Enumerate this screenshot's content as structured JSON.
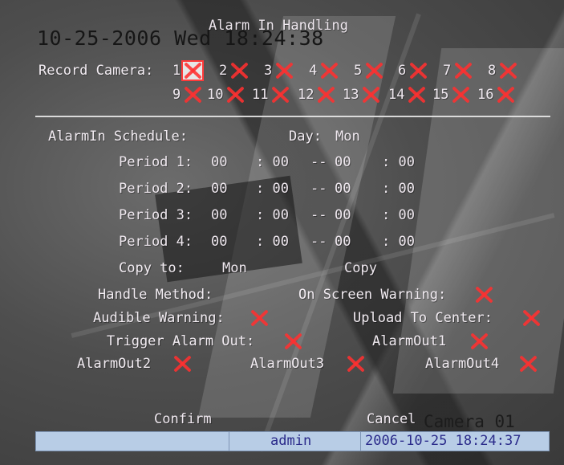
{
  "title": "Alarm In Handling",
  "clock": "10-25-2006 Wed 18:24:38",
  "record_camera": {
    "label": "Record Camera:",
    "cameras": [
      "1",
      "2",
      "3",
      "4",
      "5",
      "6",
      "7",
      "8",
      "9",
      "10",
      "11",
      "12",
      "13",
      "14",
      "15",
      "16"
    ],
    "selected": "1"
  },
  "schedule": {
    "label": "AlarmIn Schedule:",
    "day_label": "Day:",
    "day_value": "Mon",
    "periods": [
      {
        "label": "Period 1:",
        "start_h": "00",
        "start_m": ": 00",
        "dash": "--",
        "end_h": "00",
        "end_m": ": 00"
      },
      {
        "label": "Period 2:",
        "start_h": "00",
        "start_m": ": 00",
        "dash": "--",
        "end_h": "00",
        "end_m": ": 00"
      },
      {
        "label": "Period 3:",
        "start_h": "00",
        "start_m": ": 00",
        "dash": "--",
        "end_h": "00",
        "end_m": ": 00"
      },
      {
        "label": "Period 4:",
        "start_h": "00",
        "start_m": ": 00",
        "dash": "--",
        "end_h": "00",
        "end_m": ": 00"
      }
    ],
    "copy_to_label": "Copy to:",
    "copy_to_value": "Mon",
    "copy_button": "Copy"
  },
  "handle": {
    "method_label": "Handle Method:",
    "on_screen_warning": "On Screen Warning:",
    "audible_warning": "Audible Warning:",
    "upload_to_center": "Upload To Center:",
    "trigger_alarm_out": "Trigger Alarm Out:",
    "alarm_outs": [
      "AlarmOut1",
      "AlarmOut2",
      "AlarmOut3",
      "AlarmOut4"
    ]
  },
  "buttons": {
    "confirm": "Confirm",
    "cancel": "Cancel"
  },
  "camera_name": "Camera 01",
  "status": {
    "user": "admin",
    "datetime": "2006-10-25 18:24:37"
  },
  "colors": {
    "check_mark": "#ff3030",
    "status_bar": "#b8cde6",
    "status_text": "#2a2a8a"
  },
  "icons": {
    "unchecked": "red-x-icon",
    "selected": "selected-checkbox-icon"
  }
}
